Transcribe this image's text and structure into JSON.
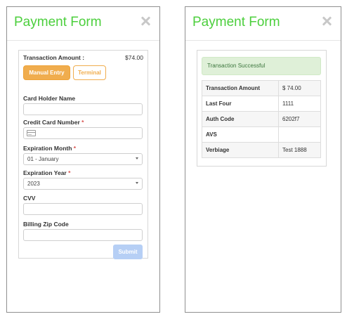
{
  "left_panel": {
    "title": "Payment Form",
    "form": {
      "amount_label": "Transaction Amount :",
      "amount_value": "$74.00",
      "tabs": {
        "manual": "Manual Entry",
        "terminal": "Terminal"
      },
      "card_holder_label": "Card Holder Name",
      "card_number_label": "Credit Card Number",
      "required_mark": "*",
      "exp_month_label": "Expiration Month",
      "exp_month_value": "01 - January",
      "exp_year_label": "Expiration Year",
      "exp_year_value": "2023",
      "cvv_label": "CVV",
      "zip_label": "Billing Zip Code",
      "submit_label": "Submit"
    }
  },
  "right_panel": {
    "title": "Payment Form",
    "alert": "Transaction Successful",
    "rows": [
      {
        "key": "Transaction Amount",
        "value": "$ 74.00"
      },
      {
        "key": "Last Four",
        "value": "1111"
      },
      {
        "key": "Auth Code",
        "value": "6202f7"
      },
      {
        "key": "AVS",
        "value": ""
      },
      {
        "key": "Verbiage",
        "value": "Test 1888"
      }
    ]
  },
  "colors": {
    "title_green": "#4ccf3d",
    "orange": "#f0ad4e",
    "submit_disabled": "#b6cff5",
    "success_bg": "#dff0d8",
    "success_text": "#3c763d",
    "required_red": "#d9534f"
  }
}
